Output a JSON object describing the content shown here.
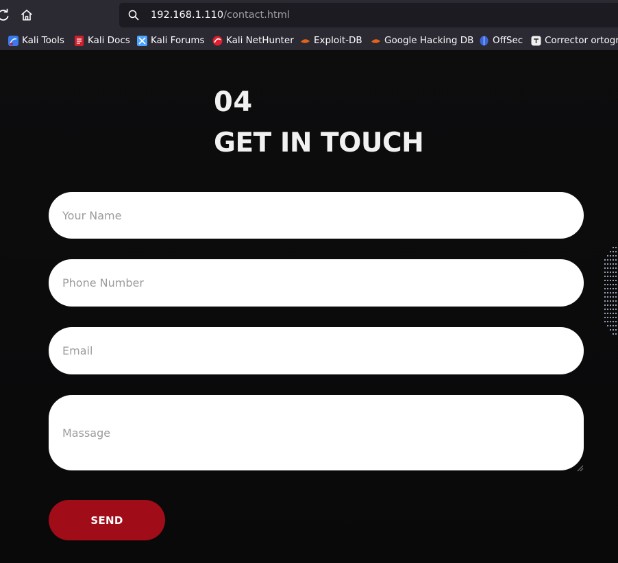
{
  "browser": {
    "url_host": "192.168.1.110",
    "url_path": "/contact.html",
    "bookmarks": [
      {
        "label": "Kali Tools",
        "icon": "kali-tools-icon",
        "color": "#367bf0"
      },
      {
        "label": "Kali Docs",
        "icon": "kali-docs-icon",
        "color": "#d21f2c"
      },
      {
        "label": "Kali Forums",
        "icon": "kali-forums-icon",
        "color": "#4aa3ff"
      },
      {
        "label": "Kali NetHunter",
        "icon": "kali-nethunter-icon",
        "color": "#e0202e"
      },
      {
        "label": "Exploit-DB",
        "icon": "exploit-db-icon",
        "color": "#e5631a"
      },
      {
        "label": "Google Hacking DB",
        "icon": "ghdb-icon",
        "color": "#e5631a"
      },
      {
        "label": "OffSec",
        "icon": "offsec-icon",
        "color": "#3b66d8"
      },
      {
        "label": "Corrector ortogr",
        "icon": "corrector-icon",
        "color": "#f0f0f0"
      }
    ]
  },
  "section": {
    "number": "04",
    "title": "GET IN TOUCH"
  },
  "form": {
    "name_placeholder": "Your Name",
    "phone_placeholder": "Phone Number",
    "email_placeholder": "Email",
    "message_placeholder": "Massage",
    "send_label": "SEND"
  },
  "colors": {
    "background": "#0b0b0c",
    "accent": "#a10c19",
    "heading": "#f1f1f1",
    "field": "#ffffff"
  }
}
